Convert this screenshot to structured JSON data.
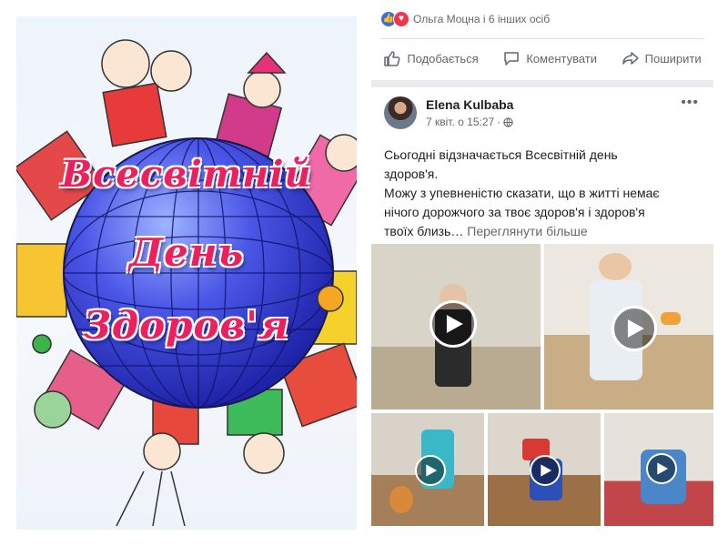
{
  "poster": {
    "title_line1": "Всесвітній",
    "title_line2": "День",
    "title_line3": "Здоров'я"
  },
  "feed": {
    "reactions_text": "Ольга Моцна і 6 інших осіб",
    "actions": {
      "like": "Подобається",
      "comment": "Коментувати",
      "share": "Поширити"
    },
    "post": {
      "author": "Elena Kulbaba",
      "timestamp": "7 квіт. о 15:27",
      "text_line1": "Сьогодні відзначається Всесвітній день",
      "text_line2": "здоров'я.",
      "text_line3": "Можу з упевненістю сказати, що в житті немає",
      "text_line4": "нічого дорожчого за твоє здоров'я і здоров'я",
      "text_line5": "твоїх близь…",
      "see_more": "Переглянути більше"
    }
  },
  "colors": {
    "title_pink": "#ee1f5f",
    "globe_blue": "#3a3fd4",
    "fb_like_blue": "#3b6fd8",
    "fb_love_red": "#f0364e"
  }
}
